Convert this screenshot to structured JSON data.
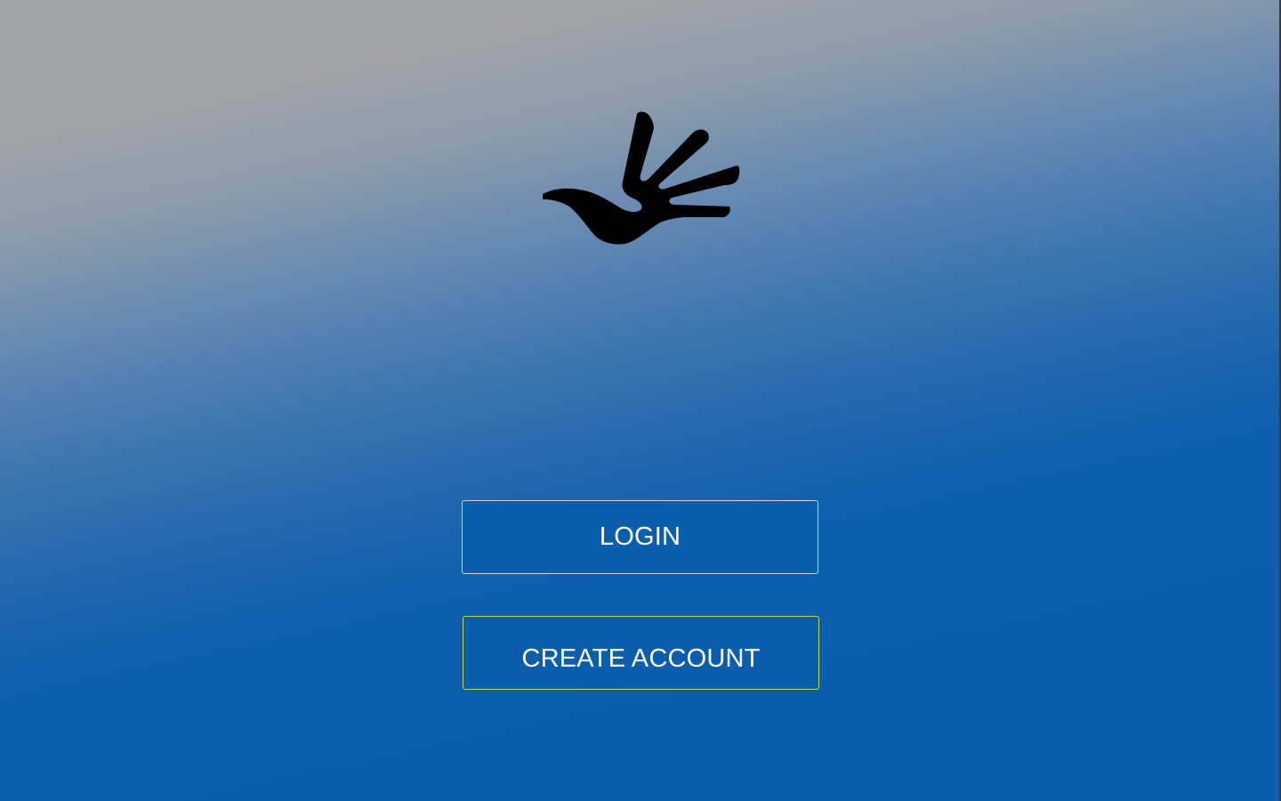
{
  "app": {
    "logo_icon": "hand-dove-logo-icon"
  },
  "colors": {
    "background_top": "#a0a4a9",
    "background_bottom": "#0a5eae",
    "button_fill": "#0b5eae",
    "login_border": "#c9d6e6",
    "create_account_border": "#c2d93a",
    "button_text": "#ffffff"
  },
  "actions": {
    "login_label": "LOGIN",
    "create_account_label": "CREATE ACCOUNT"
  }
}
